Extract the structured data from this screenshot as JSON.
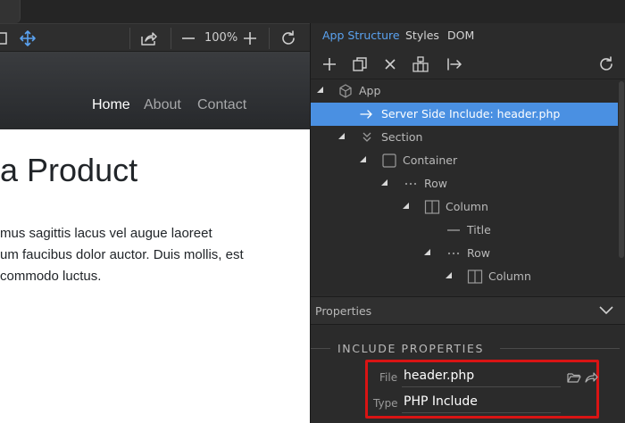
{
  "preview": {
    "nav": {
      "home": "Home",
      "about": "About",
      "contact": "Contact"
    },
    "headline": "a Product",
    "body_lines": [
      "mus sagittis lacus vel augue laoreet",
      "um faucibus dolor auctor. Duis mollis, est",
      " commodo luctus."
    ]
  },
  "toolbar": {
    "zoom": "100%"
  },
  "panel_tabs": {
    "app_structure": "App Structure",
    "styles": "Styles",
    "dom": "DOM"
  },
  "tree": {
    "items": [
      {
        "label": "App"
      },
      {
        "label": "Server Side Include: header.php"
      },
      {
        "label": "Section"
      },
      {
        "label": "Container"
      },
      {
        "label": "Row"
      },
      {
        "label": "Column"
      },
      {
        "label": "Title"
      },
      {
        "label": "Row"
      },
      {
        "label": "Column"
      }
    ]
  },
  "properties": {
    "title": "Properties",
    "section_title": "INCLUDE PROPERTIES",
    "file_label": "File",
    "file_value": "header.php",
    "type_label": "Type",
    "type_value": "PHP Include"
  },
  "colors": {
    "accent": "#4a90e2",
    "tab_active": "#5aa2f0",
    "highlight_border": "#d91414"
  }
}
